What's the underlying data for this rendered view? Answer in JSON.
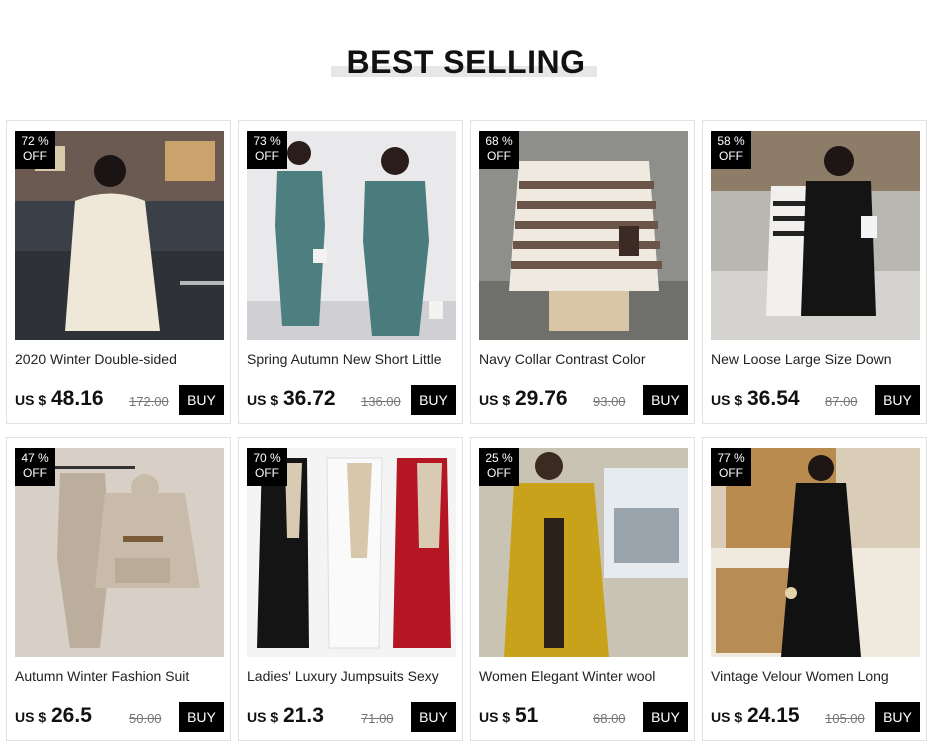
{
  "section": {
    "title": "BEST SELLING"
  },
  "products": [
    {
      "title": "2020 Winter Double-sided",
      "currency": "US $",
      "price": "48.16",
      "old_price": "172.00",
      "discount": "72 %",
      "off": "OFF",
      "buy": "BUY",
      "image": "woman-cream-coat-photo"
    },
    {
      "title": "Spring Autumn New Short Little",
      "currency": "US $",
      "price": "36.72",
      "old_price": "136.00",
      "discount": "73 %",
      "off": "OFF",
      "buy": "BUY",
      "image": "teal-suit-photo"
    },
    {
      "title": "Navy Collar Contrast Color",
      "currency": "US $",
      "price": "29.76",
      "old_price": "93.00",
      "discount": "68 %",
      "off": "OFF",
      "buy": "BUY",
      "image": "striped-sweater-photo"
    },
    {
      "title": "New Loose Large Size Down",
      "currency": "US $",
      "price": "36.54",
      "old_price": "87.00",
      "discount": "58 %",
      "off": "OFF",
      "buy": "BUY",
      "image": "black-vest-photo"
    },
    {
      "title": "Autumn Winter Fashion Suit",
      "currency": "US $",
      "price": "26.5",
      "old_price": "50.00",
      "discount": "47 %",
      "off": "OFF",
      "buy": "BUY",
      "image": "hoodie-set-photo"
    },
    {
      "title": "Ladies' Luxury Jumpsuits Sexy",
      "currency": "US $",
      "price": "21.3",
      "old_price": "71.00",
      "discount": "70 %",
      "off": "OFF",
      "buy": "BUY",
      "image": "jumpsuits-photo"
    },
    {
      "title": "Women Elegant Winter wool",
      "currency": "US $",
      "price": "51",
      "old_price": "68.00",
      "discount": "25 %",
      "off": "OFF",
      "buy": "BUY",
      "image": "yellow-wool-coat-photo"
    },
    {
      "title": "Vintage Velour Women Long",
      "currency": "US $",
      "price": "24.15",
      "old_price": "105.00",
      "discount": "77 %",
      "off": "OFF",
      "buy": "BUY",
      "image": "velour-dress-photo"
    }
  ]
}
